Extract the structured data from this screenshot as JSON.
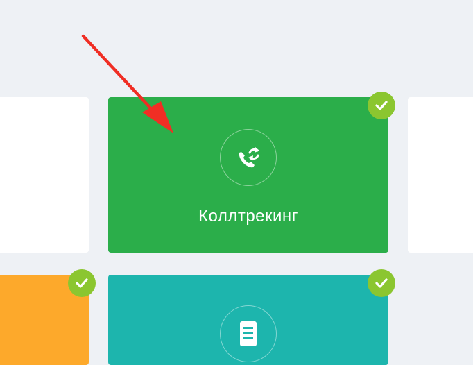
{
  "cards": {
    "calltracking": {
      "title": "Коллтрекинг",
      "icon": "phone-sync-icon",
      "color": "#2bae4a",
      "checked": true
    },
    "orange": {
      "color": "#fda92b",
      "checked": true
    },
    "teal": {
      "icon": "document-icon",
      "color": "#1db5ad",
      "checked": true
    }
  },
  "colors": {
    "background": "#eef1f5",
    "check_badge": "#8bc630",
    "arrow": "#f02e24"
  }
}
